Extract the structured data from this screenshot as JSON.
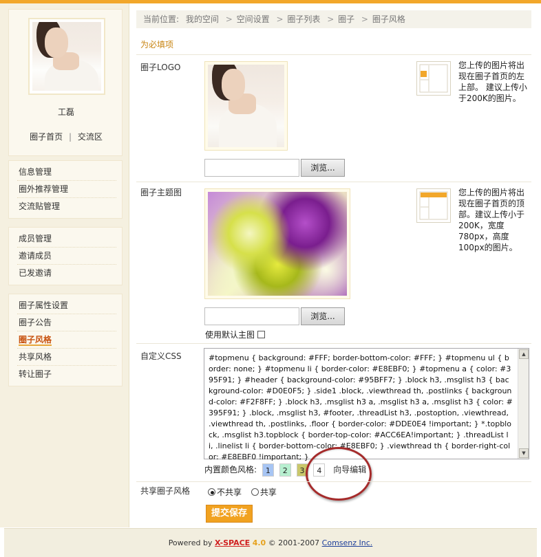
{
  "sidebar": {
    "profile": {
      "name": "工磊",
      "links": [
        "圈子首页",
        "交流区"
      ],
      "link_separator": "|"
    },
    "menu_groups": [
      {
        "items": [
          {
            "label": "信息管理"
          },
          {
            "label": "圈外推荐管理"
          },
          {
            "label": "交流贴管理"
          }
        ]
      },
      {
        "items": [
          {
            "label": "成员管理"
          },
          {
            "label": "邀请成员"
          },
          {
            "label": "已发邀请"
          }
        ]
      },
      {
        "items": [
          {
            "label": "圈子属性设置"
          },
          {
            "label": "圈子公告"
          },
          {
            "label": "圈子风格",
            "active": true
          },
          {
            "label": "共享风格"
          },
          {
            "label": "转让圈子"
          }
        ]
      }
    ]
  },
  "breadcrumb": {
    "prefix": "当前位置:",
    "items": [
      "我的空间",
      "空间设置",
      "圈子列表",
      "圈子",
      "圈子风格"
    ],
    "separator": ">"
  },
  "form": {
    "required_note": "为必填项",
    "logo": {
      "label": "圈子LOGO",
      "browse_label": "浏览...",
      "description": "您上传的图片将出现在圈子首页的左上部。 建议上传小于200K的图片。"
    },
    "banner": {
      "label": "圈子主题图",
      "browse_label": "浏览...",
      "description": "您上传的图片将出现在圈子首页的顶部。建议上传小于200K，宽度780px，高度100px的图片。",
      "use_default_label": "使用默认主图"
    },
    "custom_css": {
      "label": "自定义CSS",
      "value": "#topmenu { background: #FFF; border-bottom-color: #FFF; } #topmenu ul { border: none; } #topmenu li { border-color: #E8EBF0; } #topmenu a { color: #395F91; } #header { background-color: #95BFF7; } .block h3, .msglist h3 { background-color: #D0E0F5; } .side1 .block, .viewthread th, .postlinks { background-color: #F2F8FF; } .block h3, .msglist h3 a, .msglist h3 a, .msglist h3 { color: #395F91; } .block, .msglist h3, #footer, .threadList h3, .postoption, .viewthread, .viewthread th, .postlinks, .floor { border-color: #DDE0E4 !important; } *.topblock, .msglist h3.topblock { border-top-color: #ACC6EA!important; } .threadList li, .linelist li { border-bottom-color: #E8EBF0; } .viewthread th { border-right-color: #E8EBF0 !important; }",
      "builtin_styles_label": "内置颜色风格:",
      "styles": [
        {
          "num": "1",
          "color": "#A7C5F4"
        },
        {
          "num": "2",
          "color": "#B7EFD0"
        },
        {
          "num": "3",
          "color": "#C9C76A"
        },
        {
          "num": "4",
          "color": "#FFFFFF"
        }
      ],
      "wizard_label": "向导编辑"
    },
    "share_style": {
      "label": "共享圈子风格",
      "options": [
        {
          "label": "不共享",
          "checked": true
        },
        {
          "label": "共享",
          "checked": false
        }
      ]
    },
    "submit_label": "提交保存"
  },
  "footer": {
    "powered_by": "Powered by",
    "product": "X-SPACE",
    "version": "4.0",
    "copyright": "© 2001-2007",
    "company": "Comsenz Inc."
  },
  "colors": {
    "accent": "#F2A72B",
    "annotation": "#A52B2B",
    "active_menu": "#C8520F"
  }
}
